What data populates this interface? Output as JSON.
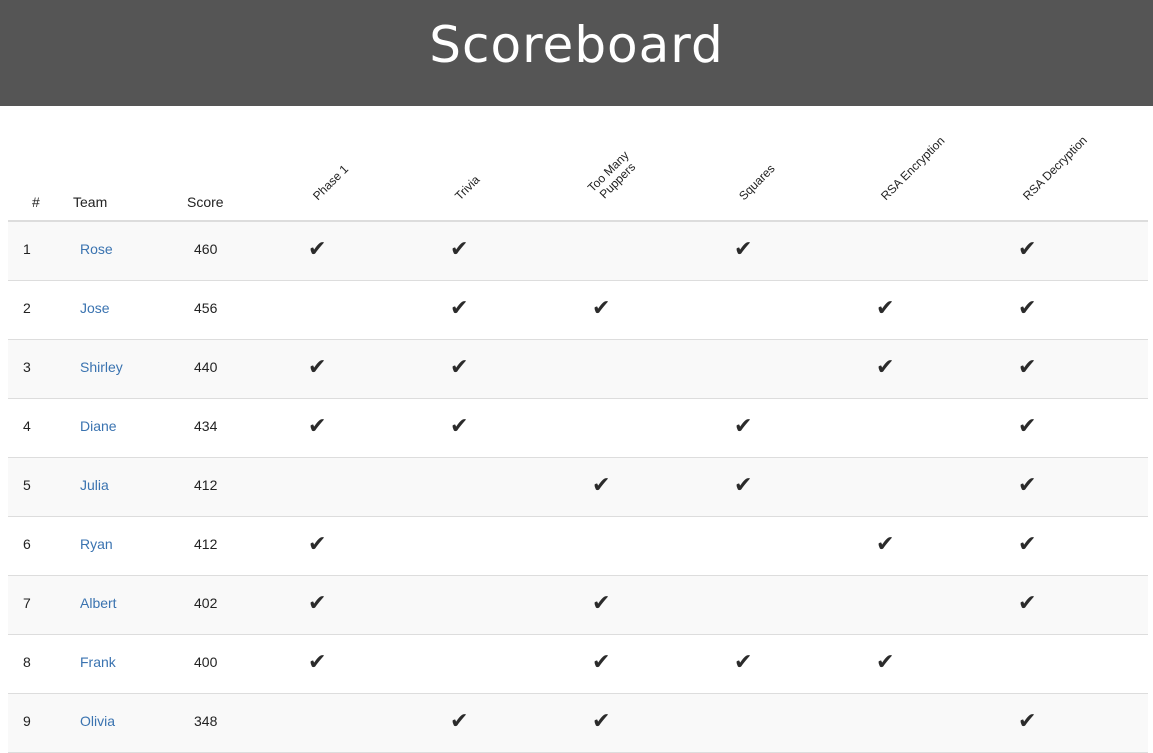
{
  "title": "Scoreboard",
  "columns": {
    "rank": "#",
    "team": "Team",
    "score": "Score"
  },
  "challenges": [
    [
      "Phase 1"
    ],
    [
      "Trivia"
    ],
    [
      "Too Many",
      "Puppers"
    ],
    [
      "Squares"
    ],
    [
      "RSA Encryption"
    ],
    [
      "RSA Decryption"
    ]
  ],
  "check_glyph": "✔",
  "teams": [
    {
      "rank": "1",
      "name": "Rose",
      "score": "460",
      "solved": [
        true,
        true,
        false,
        true,
        false,
        true
      ]
    },
    {
      "rank": "2",
      "name": "Jose",
      "score": "456",
      "solved": [
        false,
        true,
        true,
        false,
        true,
        true
      ]
    },
    {
      "rank": "3",
      "name": "Shirley",
      "score": "440",
      "solved": [
        true,
        true,
        false,
        false,
        true,
        true
      ]
    },
    {
      "rank": "4",
      "name": "Diane",
      "score": "434",
      "solved": [
        true,
        true,
        false,
        true,
        false,
        true
      ]
    },
    {
      "rank": "5",
      "name": "Julia",
      "score": "412",
      "solved": [
        false,
        false,
        true,
        true,
        false,
        true
      ]
    },
    {
      "rank": "6",
      "name": "Ryan",
      "score": "412",
      "solved": [
        true,
        false,
        false,
        false,
        true,
        true
      ]
    },
    {
      "rank": "7",
      "name": "Albert",
      "score": "402",
      "solved": [
        true,
        false,
        true,
        false,
        false,
        true
      ]
    },
    {
      "rank": "8",
      "name": "Frank",
      "score": "400",
      "solved": [
        true,
        false,
        true,
        true,
        true,
        false
      ]
    },
    {
      "rank": "9",
      "name": "Olivia",
      "score": "348",
      "solved": [
        false,
        true,
        true,
        false,
        false,
        true
      ]
    }
  ],
  "colors": {
    "header_bg": "#555555",
    "link": "#3a73b0",
    "stripe": "#f9f9f9"
  }
}
